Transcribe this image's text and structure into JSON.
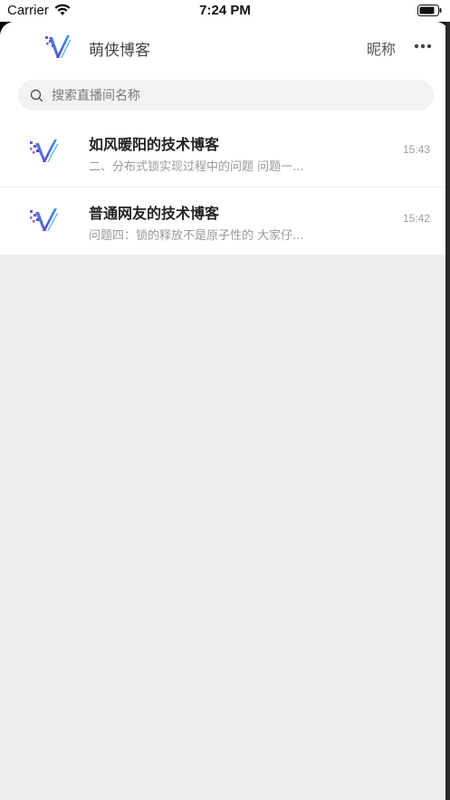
{
  "status_bar": {
    "carrier": "Carrier",
    "time": "7:24 PM",
    "icons": [
      "wifi-icon",
      "battery-icon"
    ]
  },
  "header": {
    "title": "萌侠博客",
    "nickname": "昵称",
    "logo_icon": "logo-icon",
    "more_icon": "more-icon"
  },
  "search": {
    "placeholder": "搜索直播间名称",
    "icon": "search-icon"
  },
  "conversations": [
    {
      "name": "如风暖阳的技术博客",
      "preview": "二、分布式锁实现过程中的问题 问题一...",
      "time": "15:43"
    },
    {
      "name": "普通网友的技术博客",
      "preview": "问题四：锁的释放不是原子性的 大家仔...",
      "time": "15:42"
    }
  ],
  "colors": {
    "background": "#efefef",
    "card": "#ffffff",
    "logo_purple": "#6a3fc8",
    "logo_blue": "#3aa0e8"
  }
}
